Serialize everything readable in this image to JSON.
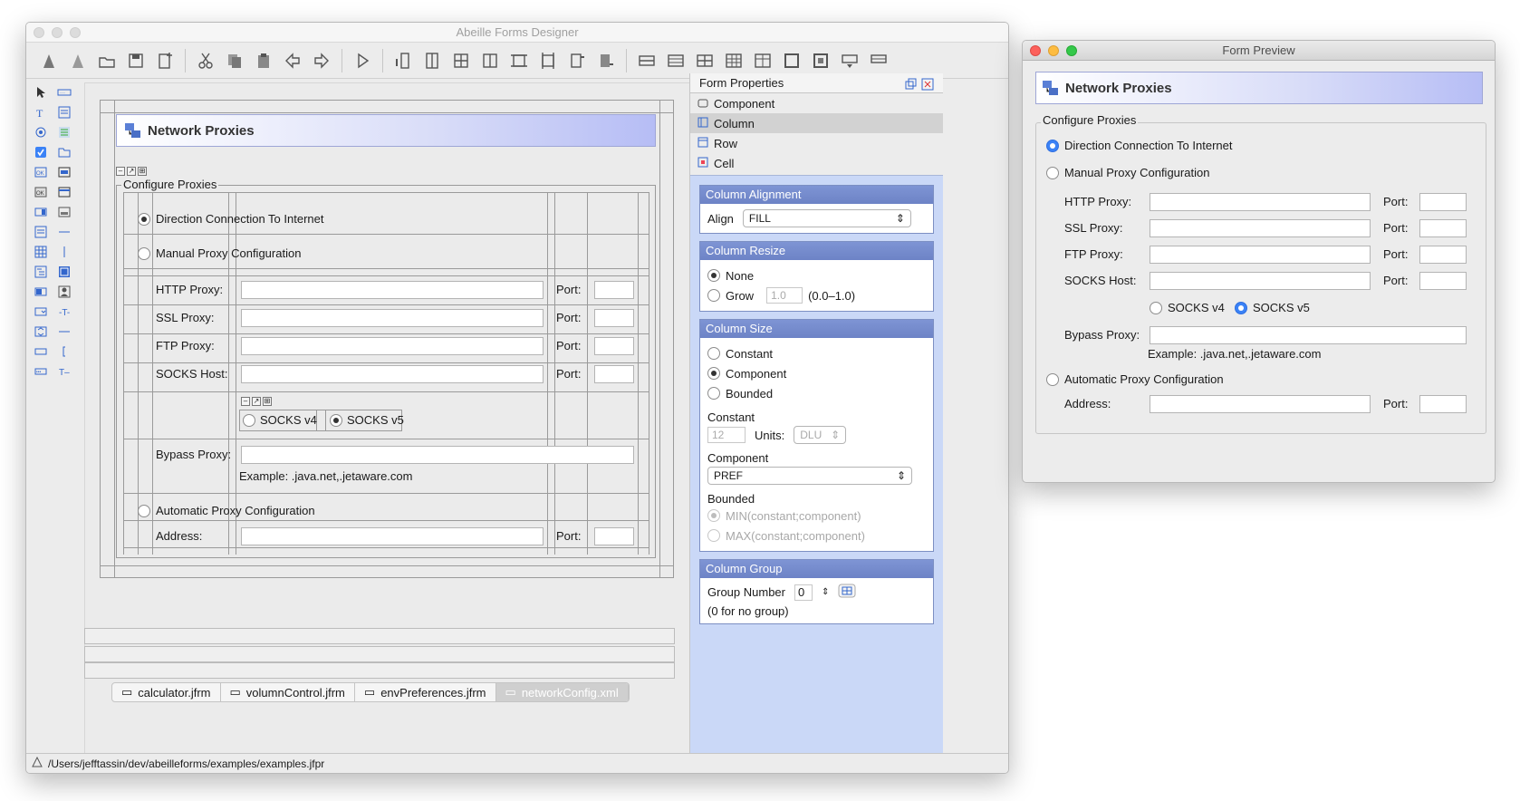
{
  "designer": {
    "title": "Abeille Forms Designer",
    "form": {
      "banner_title": "Network Proxies",
      "group_title": "Configure Proxies",
      "radio_direct": "Direction Connection To Internet",
      "radio_manual": "Manual Proxy Configuration",
      "http_label": "HTTP Proxy:",
      "ssl_label": "SSL Proxy:",
      "ftp_label": "FTP Proxy:",
      "socks_label": "SOCKS Host:",
      "port_label": "Port:",
      "socks_v4": "SOCKS v4",
      "socks_v5": "SOCKS v5",
      "bypass_label": "Bypass Proxy:",
      "example": "Example: .java.net,.jetaware.com",
      "radio_auto": "Automatic Proxy Configuration",
      "address_label": "Address:"
    },
    "properties": {
      "title": "Form Properties",
      "nodes": [
        "Component",
        "Column",
        "Row",
        "Cell"
      ],
      "selected": "Column",
      "alignment": {
        "header": "Column Alignment",
        "label": "Align",
        "value": "FILL"
      },
      "resize": {
        "header": "Column Resize",
        "none": "None",
        "grow": "Grow",
        "grow_value": "1.0",
        "grow_range": "(0.0–1.0)"
      },
      "size": {
        "header": "Column Size",
        "constant": "Constant",
        "component": "Component",
        "bounded": "Bounded",
        "constant_label": "Constant",
        "constant_value": "12",
        "units_label": "Units:",
        "units_value": "DLU",
        "component_label": "Component",
        "component_value": "PREF",
        "bounded_label": "Bounded",
        "bounded_min": "MIN(constant;component)",
        "bounded_max": "MAX(constant;component)"
      },
      "group": {
        "header": "Column Group",
        "label": "Group Number",
        "value": "0",
        "hint": "(0 for no group)"
      }
    },
    "tabs": [
      "calculator.jfrm",
      "volumnControl.jfrm",
      "envPreferences.jfrm",
      "networkConfig.xml"
    ],
    "active_tab": "networkConfig.xml",
    "status_path": "/Users/jefftassin/dev/abeilleforms/examples/examples.jfpr"
  },
  "preview": {
    "title": "Form Preview",
    "banner_title": "Network Proxies",
    "group_title": "Configure Proxies",
    "radio_direct": "Direction Connection To Internet",
    "radio_manual": "Manual Proxy Configuration",
    "http_label": "HTTP Proxy:",
    "ssl_label": "SSL Proxy:",
    "ftp_label": "FTP Proxy:",
    "socks_label": "SOCKS Host:",
    "port_label": "Port:",
    "socks_v4": "SOCKS v4",
    "socks_v5": "SOCKS v5",
    "bypass_label": "Bypass Proxy:",
    "example": "Example: .java.net,.jetaware.com",
    "radio_auto": "Automatic Proxy Configuration",
    "address_label": "Address:"
  },
  "icons": {
    "toolbar": [
      "new-form-icon",
      "new-project-icon",
      "open-icon",
      "save-icon",
      "new-file-icon",
      "cut-icon",
      "copy-icon",
      "paste-icon",
      "undo-icon",
      "redo-icon",
      "run-icon",
      "insert-col-left-icon",
      "insert-col-right-icon",
      "col-icon",
      "col2-icon",
      "row-icon",
      "row2-icon",
      "align-icon",
      "align2-icon",
      "split-icon",
      "table-icon",
      "delete-row-icon",
      "grid-icon",
      "grid2-icon",
      "frame-icon",
      "frame2-icon",
      "dropdown-icon",
      "dropdown2-icon"
    ]
  },
  "colors": {
    "accent": "#6d83c6",
    "panel_bg": "#cad8f7",
    "radio_active": "#3b82f6"
  }
}
